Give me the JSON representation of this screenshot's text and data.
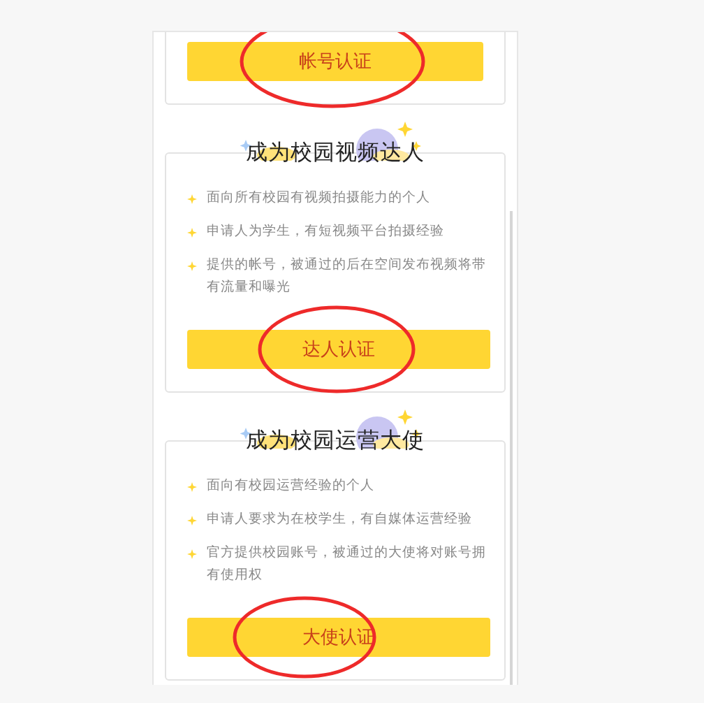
{
  "top_card": {
    "button": {
      "label": "帐号认证",
      "circled": true
    }
  },
  "sections": [
    {
      "title": "成为校园视频达人",
      "bullets": [
        "面向所有校园有视频拍摄能力的个人",
        "申请人为学生，有短视频平台拍摄经验",
        "提供的帐号，被通过的后在空间发布视频将带有流量和曝光"
      ],
      "button": {
        "label": "达人认证",
        "circled": true
      }
    },
    {
      "title": "成为校园运营大使",
      "bullets": [
        "面向有校园运营经验的个人",
        "申请人要求为在校学生，有自媒体运营经验",
        "官方提供校园账号，被通过的大使将对账号拥有使用权"
      ],
      "button": {
        "label": "大使认证",
        "circled": true
      }
    }
  ]
}
